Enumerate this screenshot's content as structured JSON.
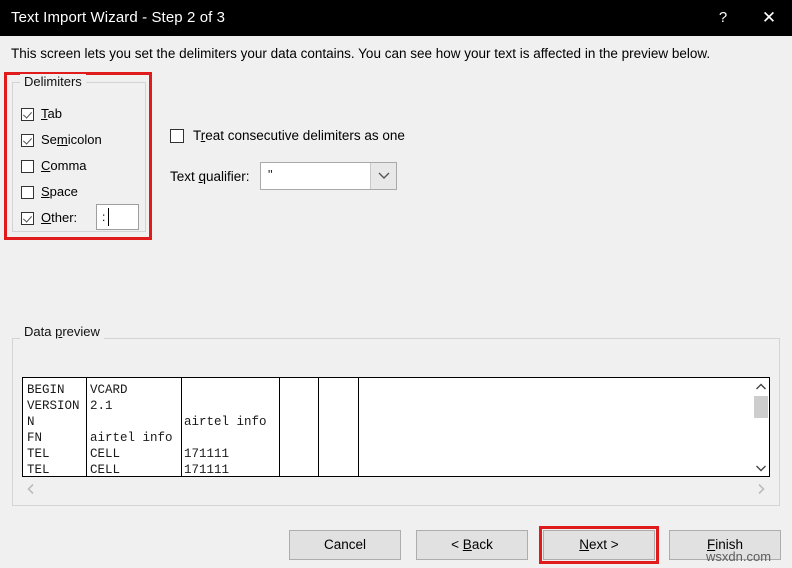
{
  "window": {
    "title": "Text Import Wizard - Step 2 of 3",
    "help_label": "?",
    "close_label": "✕"
  },
  "instruction": "This screen lets you set the delimiters your data contains.  You can see how your text is affected in the preview below.",
  "delimiters": {
    "legend": "Delimiters",
    "items": [
      {
        "label": "Tab",
        "checked": true
      },
      {
        "label": "Semicolon",
        "checked": true
      },
      {
        "label": "Comma",
        "checked": false
      },
      {
        "label": "Space",
        "checked": false
      },
      {
        "label": "Other:",
        "checked": true
      }
    ],
    "other_value": ":",
    "highlight_color": "#e01b1b"
  },
  "options": {
    "consecutive_label": "Treat consecutive delimiters as one",
    "consecutive_checked": false,
    "qualifier_label": "Text qualifier:",
    "qualifier_value": "\"",
    "qualifier_options": [
      "\"",
      "'",
      "{none}"
    ]
  },
  "preview": {
    "legend": "Data preview",
    "rows": [
      [
        "BEGIN",
        "VCARD",
        "",
        "",
        "",
        ""
      ],
      [
        "VERSION",
        "2.1",
        "",
        "",
        "",
        ""
      ],
      [
        "N",
        "",
        "airtel info",
        "",
        "",
        ""
      ],
      [
        "FN",
        "airtel info",
        "",
        "",
        "",
        ""
      ],
      [
        "TEL",
        "CELL",
        "171111",
        "",
        "",
        ""
      ],
      [
        "TEL",
        "CELL",
        "171111",
        "",
        "",
        ""
      ]
    ],
    "scroll_up_icon": "chevron-up-icon",
    "scroll_down_icon": "chevron-down-icon",
    "scroll_left_icon": "chevron-left-icon",
    "scroll_right_icon": "chevron-right-icon"
  },
  "buttons": {
    "cancel": "Cancel",
    "back": "< Back",
    "next": "Next >",
    "finish": "Finish",
    "highlighted": "next"
  },
  "watermark": "wsxdn.com"
}
